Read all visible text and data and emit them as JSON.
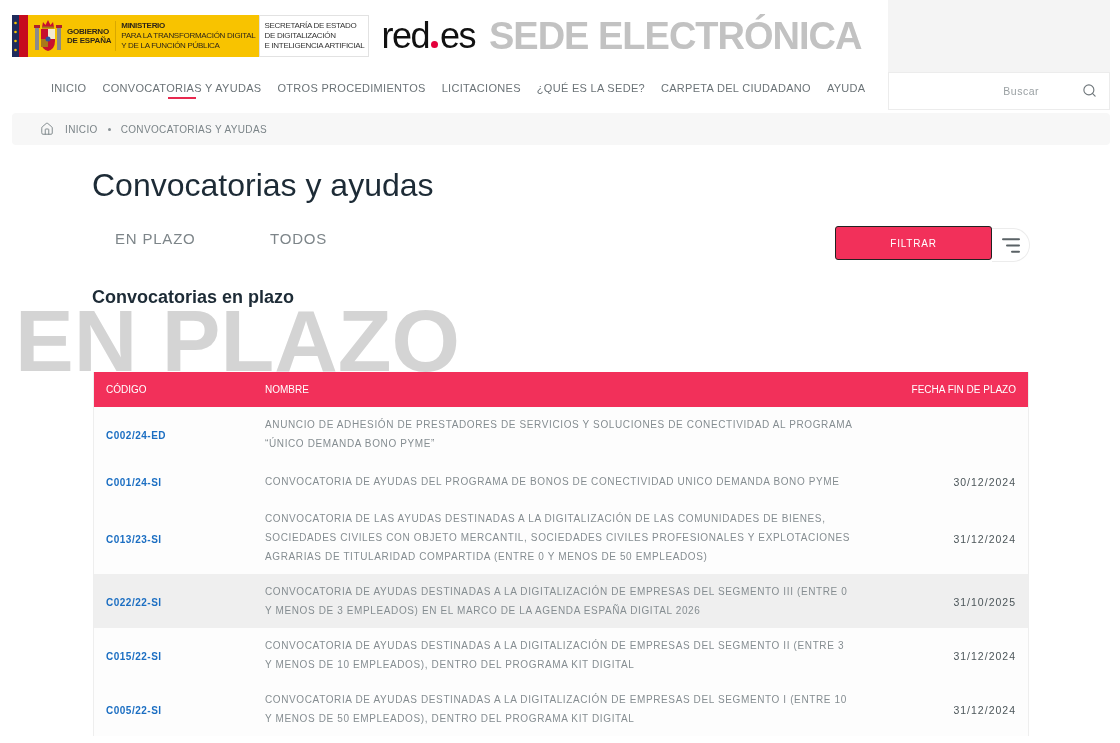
{
  "header": {
    "government_logo": {
      "government": [
        "GOBIERNO",
        "DE ESPAÑA"
      ],
      "ministry": [
        "MINISTERIO",
        "PARA LA TRANSFORMACIÓN DIGITAL",
        "Y DE LA FUNCIÓN PÚBLICA"
      ],
      "secretariat": [
        "SECRETARÍA DE ESTADO",
        "DE DIGITALIZACIÓN",
        "E INTELIGENCIA ARTIFICIAL"
      ]
    },
    "site_logo": {
      "before_dot": "red",
      "after_dot": "es"
    },
    "site_title": "SEDE ELECTRÓNICA",
    "search": {
      "placeholder": "Buscar"
    }
  },
  "nav": [
    {
      "label": "INICIO",
      "selected": false
    },
    {
      "label": "CONVOCATORIAS Y AYUDAS",
      "selected": true
    },
    {
      "label": "OTROS PROCEDIMIENTOS",
      "selected": false
    },
    {
      "label": "LICITACIONES",
      "selected": false
    },
    {
      "label": "¿QUÉ ES LA SEDE?",
      "selected": false
    },
    {
      "label": "CARPETA DEL CIUDADANO",
      "selected": false
    },
    {
      "label": "AYUDA",
      "selected": false
    }
  ],
  "breadcrumb": [
    "INICIO",
    "CONVOCATORIAS Y AYUDAS"
  ],
  "page_title": "Convocatorias y ayudas",
  "tabs": [
    {
      "label": "EN PLAZO"
    },
    {
      "label": "TODOS"
    }
  ],
  "filter_button": "FILTRAR",
  "section": {
    "background_label": "EN PLAZO",
    "title": "Convocatorias en plazo"
  },
  "table": {
    "columns": [
      "CÓDIGO",
      "NOMBRE",
      "FECHA FIN DE PLAZO"
    ],
    "rows": [
      {
        "code": "C002/24-ED",
        "name": "ANUNCIO DE ADHESIÓN DE PRESTADORES DE SERVICIOS Y SOLUCIONES DE CONECTIVIDAD AL PROGRAMA “ÚNICO DEMANDA BONO PYME”",
        "highlighted": false
      },
      {
        "code": "C001/24-SI",
        "name": "CONVOCATORIA DE AYUDAS DEL PROGRAMA DE BONOS DE CONECTIVIDAD UNICO DEMANDA BONO PYME",
        "deadline": "30/12/2024",
        "highlighted": false
      },
      {
        "code": "C013/23-SI",
        "name": "CONVOCATORIA DE LAS AYUDAS DESTINADAS A LA DIGITALIZACIÓN DE LAS COMUNIDADES DE BIENES, SOCIEDADES CIVILES CON OBJETO MERCANTIL, SOCIEDADES CIVILES PROFESIONALES Y EXPLOTACIONES AGRARIAS DE TITULARIDAD COMPARTIDA (ENTRE 0 Y MENOS DE 50 EMPLEADOS)",
        "deadline": "31/12/2024",
        "highlighted": false
      },
      {
        "code": "C022/22-SI",
        "name": "CONVOCATORIA DE AYUDAS DESTINADAS A LA DIGITALIZACIÓN DE EMPRESAS DEL SEGMENTO III (ENTRE 0 Y MENOS DE 3 EMPLEADOS) EN EL MARCO DE LA AGENDA ESPAÑA DIGITAL 2026",
        "deadline": "31/10/2025",
        "highlighted": true
      },
      {
        "code": "C015/22-SI",
        "name": "CONVOCATORIA DE AYUDAS DESTINADAS A LA DIGITALIZACIÓN DE EMPRESAS DEL SEGMENTO II (ENTRE 3 Y MENOS DE 10 EMPLEADOS), DENTRO DEL PROGRAMA KIT DIGITAL",
        "deadline": "31/12/2024",
        "highlighted": false
      },
      {
        "code": "C005/22-SI",
        "name": "CONVOCATORIA DE AYUDAS DESTINADAS A LA DIGITALIZACIÓN DE EMPRESAS DEL SEGMENTO I (ENTRE 10 Y MENOS DE 50 EMPLEADOS), DENTRO DEL PROGRAMA KIT DIGITAL",
        "deadline": "31/12/2024",
        "highlighted": false
      }
    ]
  }
}
